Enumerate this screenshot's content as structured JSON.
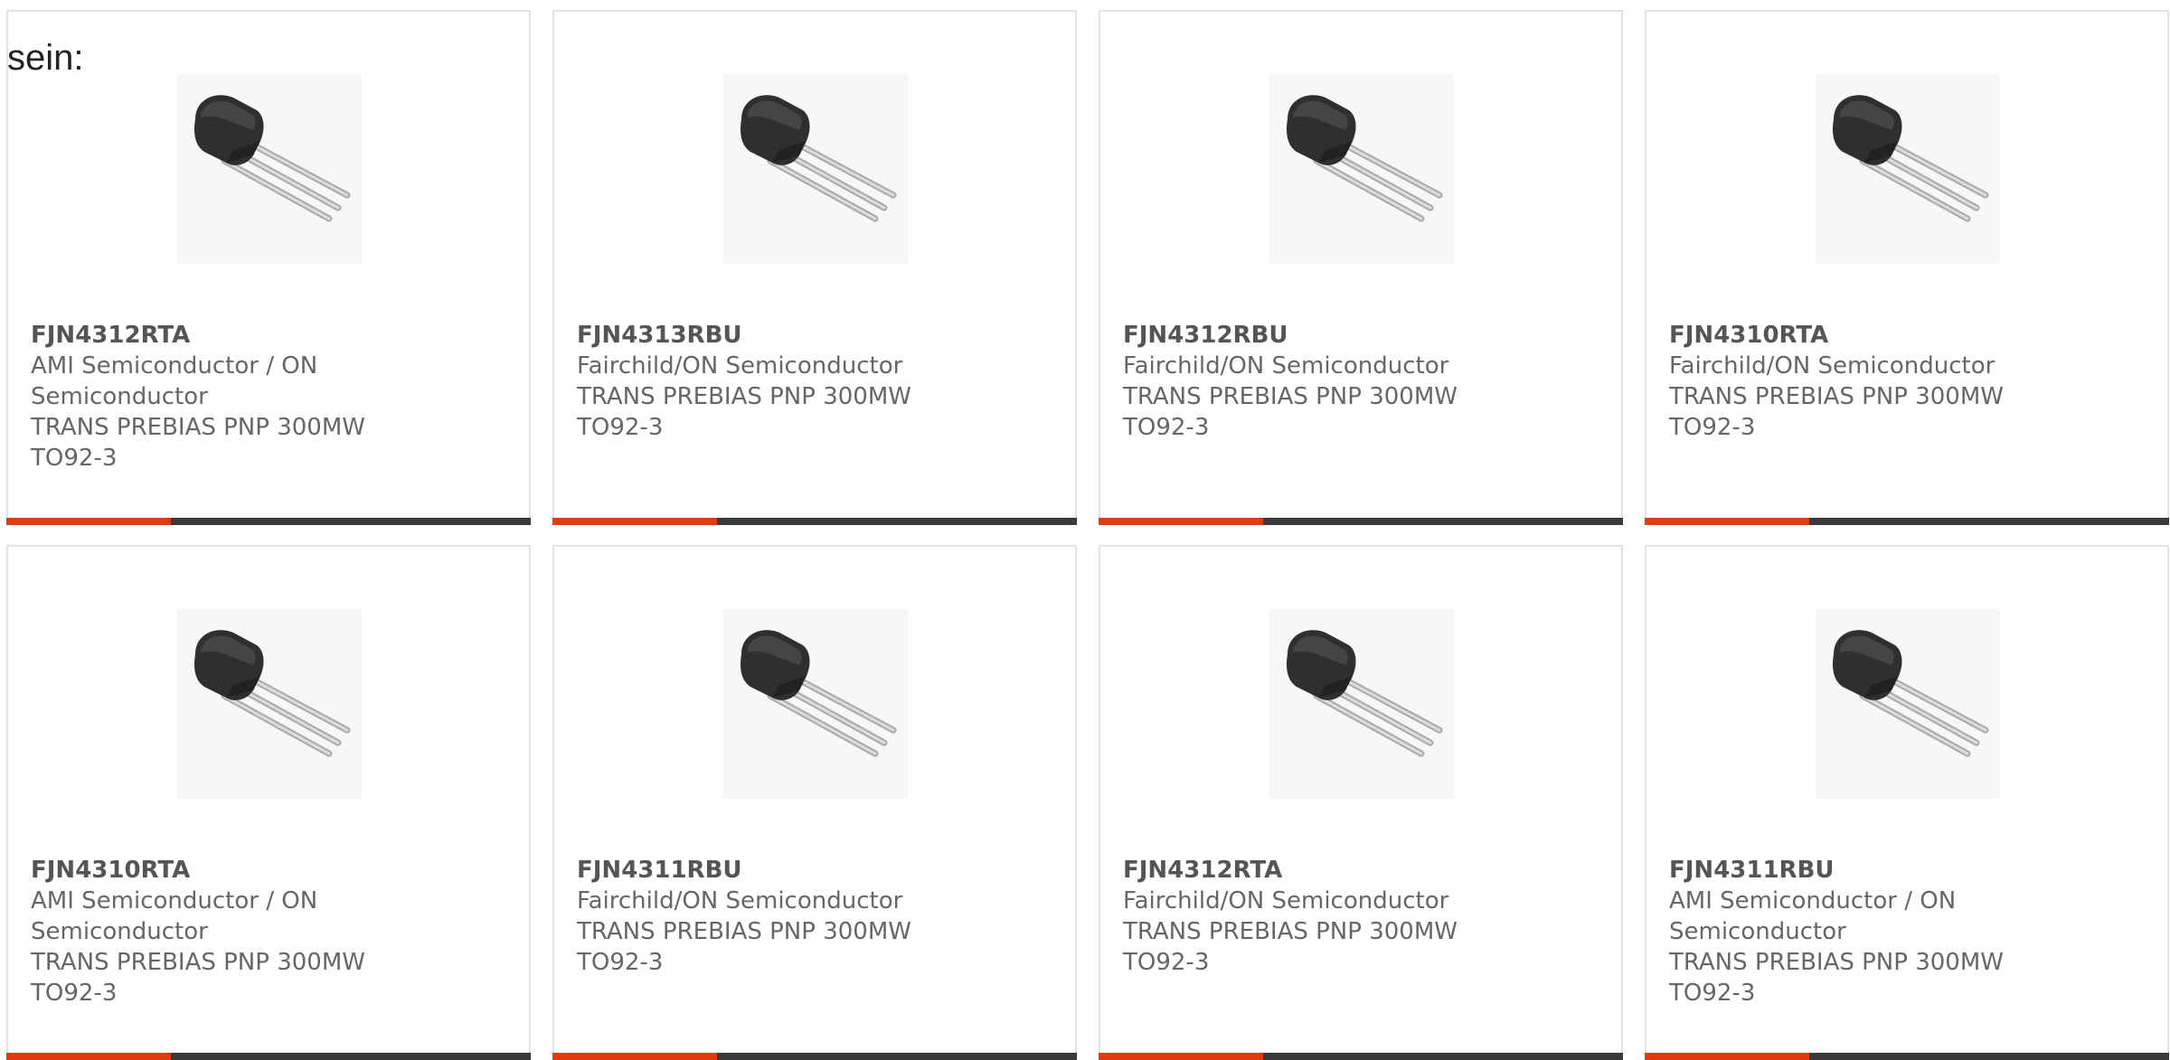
{
  "intro_text": "sein:",
  "colors": {
    "accent": "#e03a0e",
    "bar": "#3a3a3a",
    "text": "#666666",
    "border": "#e3e3e3"
  },
  "products": [
    {
      "part_number": "FJN4312RTA",
      "manufacturer": "AMI Semiconductor / ON Semiconductor",
      "description": "TRANS PREBIAS PNP 300MW TO92-3",
      "image_icon": "transistor-to92-image"
    },
    {
      "part_number": "FJN4313RBU",
      "manufacturer": "Fairchild/ON Semiconductor",
      "description": "TRANS PREBIAS PNP 300MW TO92-3",
      "image_icon": "transistor-to92-image"
    },
    {
      "part_number": "FJN4312RBU",
      "manufacturer": "Fairchild/ON Semiconductor",
      "description": "TRANS PREBIAS PNP 300MW TO92-3",
      "image_icon": "transistor-to92-image"
    },
    {
      "part_number": "FJN4310RTA",
      "manufacturer": "Fairchild/ON Semiconductor",
      "description": "TRANS PREBIAS PNP 300MW TO92-3",
      "image_icon": "transistor-to92-image"
    },
    {
      "part_number": "FJN4310RTA",
      "manufacturer": "AMI Semiconductor / ON Semiconductor",
      "description": "TRANS PREBIAS PNP 300MW TO92-3",
      "image_icon": "transistor-to92-image"
    },
    {
      "part_number": "FJN4311RBU",
      "manufacturer": "Fairchild/ON Semiconductor",
      "description": "TRANS PREBIAS PNP 300MW TO92-3",
      "image_icon": "transistor-to92-image"
    },
    {
      "part_number": "FJN4312RTA",
      "manufacturer": "Fairchild/ON Semiconductor",
      "description": "TRANS PREBIAS PNP 300MW TO92-3",
      "image_icon": "transistor-to92-image"
    },
    {
      "part_number": "FJN4311RBU",
      "manufacturer": "AMI Semiconductor / ON Semiconductor",
      "description": "TRANS PREBIAS PNP 300MW TO92-3",
      "image_icon": "transistor-to92-image"
    }
  ]
}
